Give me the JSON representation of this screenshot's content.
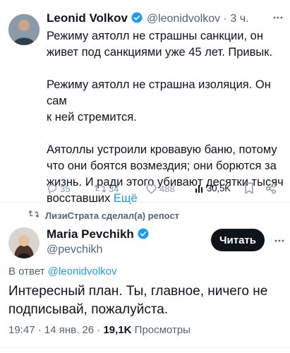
{
  "tweet1": {
    "name": "Leonid Volkov",
    "handle": "@leonidvolkov",
    "time": "· 3 ч.",
    "para1_l1": "Режиму аятолл не страшны санкции, он",
    "para1_l2": "живет под санкциями уже 45 лет. Привык.",
    "para2_l1": "Режиму аятолл не страшна изоляция. Он сам",
    "para2_l2": "к ней стремится.",
    "para3_l1": "Аятоллы устроили кровавую баню, потому",
    "para3_l2": "что они боятся возмездия; они борются за",
    "para3_l3": "жизнь. И ради этого убивают десятки тысяч",
    "para3_l4": "восставших",
    "more": "Ещё",
    "replies": "35",
    "retweets": "34",
    "likes": "488",
    "views": "30,5K"
  },
  "repost_banner": "ЛизиСтрата сделал(а) репост",
  "tweet2": {
    "name": "Maria Pevchikh",
    "handle": "@pevchikh",
    "follow_label": "Читать",
    "reply_to_prefix": "В ответ",
    "reply_to_handle": "@leonidvolkov",
    "text_l1": "Интересный план. Ты, главное, ничего не",
    "text_l2": "подписывай, пожалуйста.",
    "timestamp": "19:47 · 14 янв. 26 ·",
    "views_count": "19,1K",
    "views_label": "Просмотры"
  },
  "colors": {
    "accent": "#1d9bf0",
    "text": "#0f1419",
    "muted": "#536471"
  },
  "icons": [
    "verified-icon",
    "reply-icon",
    "retweet-icon",
    "like-icon",
    "views-icon",
    "bookmark-icon",
    "share-icon"
  ]
}
